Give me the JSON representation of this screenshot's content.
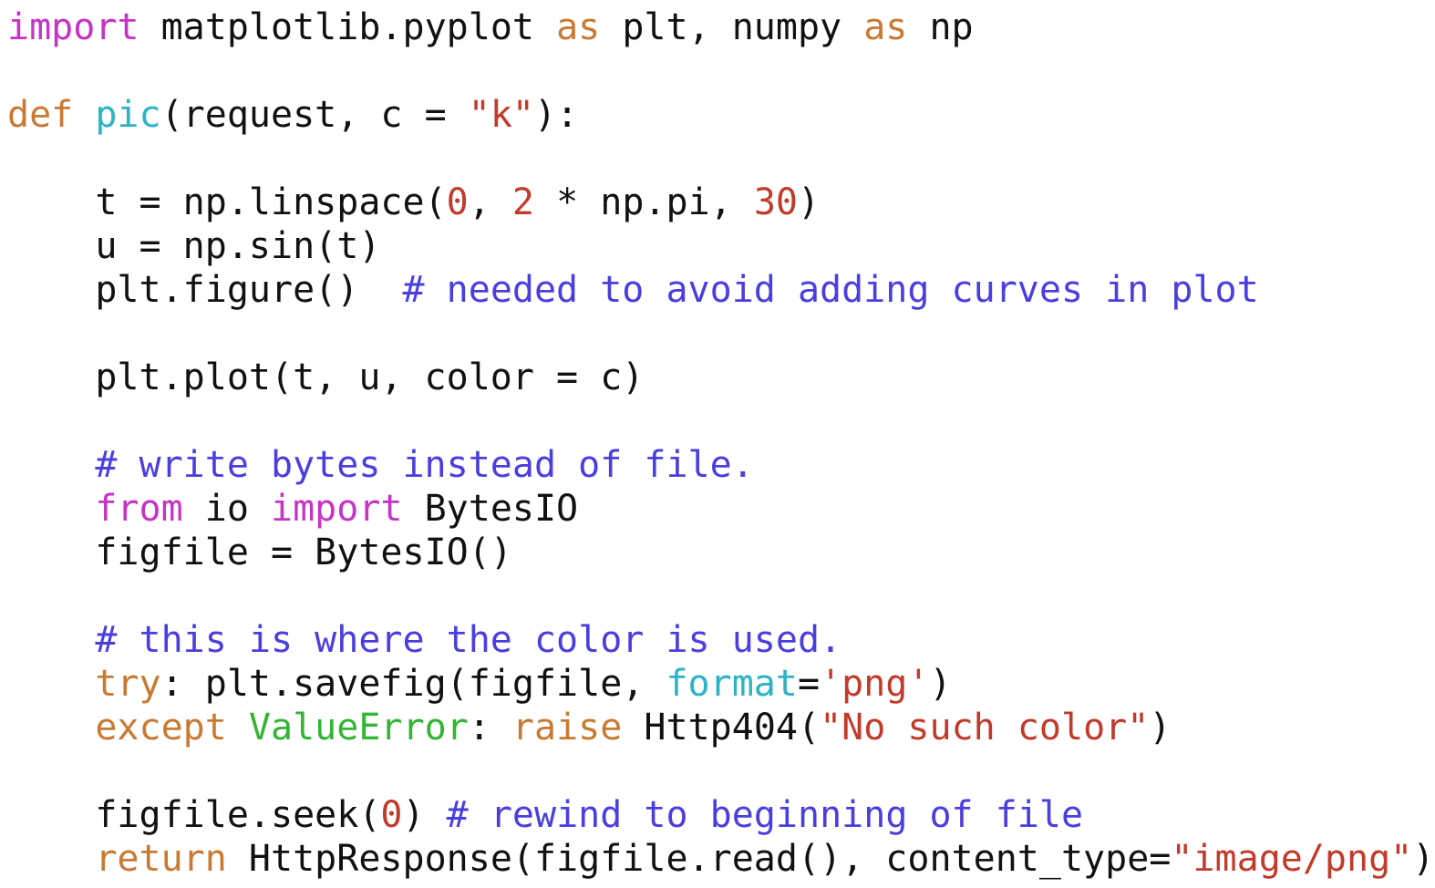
{
  "colors": {
    "plain": "#111111",
    "keyword_import": "#c534c4",
    "keyword": "#c97a32",
    "function": "#2db3c6",
    "string": "#c23a2a",
    "comment": "#4a3ee0",
    "class": "#33b533"
  },
  "code_lines": [
    [
      [
        "import",
        "keyword_import"
      ],
      [
        " matplotlib.pyplot ",
        "plain"
      ],
      [
        "as",
        "keyword"
      ],
      [
        " plt, numpy ",
        "plain"
      ],
      [
        "as",
        "keyword"
      ],
      [
        " np",
        "plain"
      ]
    ],
    [],
    [
      [
        "def",
        "keyword"
      ],
      [
        " ",
        "plain"
      ],
      [
        "pic",
        "function"
      ],
      [
        "(request, c = ",
        "plain"
      ],
      [
        "\"k\"",
        "string"
      ],
      [
        "):",
        "plain"
      ]
    ],
    [],
    [
      [
        "    t = np.linspace(",
        "plain"
      ],
      [
        "0",
        "string"
      ],
      [
        ", ",
        "plain"
      ],
      [
        "2",
        "string"
      ],
      [
        " * np.pi, ",
        "plain"
      ],
      [
        "30",
        "string"
      ],
      [
        ")",
        "plain"
      ]
    ],
    [
      [
        "    u = np.sin(t)",
        "plain"
      ]
    ],
    [
      [
        "    plt.figure()  ",
        "plain"
      ],
      [
        "# needed to avoid adding curves in plot",
        "comment"
      ]
    ],
    [],
    [
      [
        "    plt.plot(t, u, color = c)",
        "plain"
      ]
    ],
    [],
    [
      [
        "    ",
        "plain"
      ],
      [
        "# write bytes instead of file.",
        "comment"
      ]
    ],
    [
      [
        "    ",
        "plain"
      ],
      [
        "from",
        "keyword_import"
      ],
      [
        " io ",
        "plain"
      ],
      [
        "import",
        "keyword_import"
      ],
      [
        " BytesIO",
        "plain"
      ]
    ],
    [
      [
        "    figfile = BytesIO()",
        "plain"
      ]
    ],
    [],
    [
      [
        "    ",
        "plain"
      ],
      [
        "# this is where the color is used.",
        "comment"
      ]
    ],
    [
      [
        "    ",
        "plain"
      ],
      [
        "try",
        "keyword"
      ],
      [
        ": plt.savefig(figfile, ",
        "plain"
      ],
      [
        "format",
        "function"
      ],
      [
        "=",
        "plain"
      ],
      [
        "'png'",
        "string"
      ],
      [
        ")",
        "plain"
      ]
    ],
    [
      [
        "    ",
        "plain"
      ],
      [
        "except",
        "keyword"
      ],
      [
        " ",
        "plain"
      ],
      [
        "ValueError",
        "class"
      ],
      [
        ": ",
        "plain"
      ],
      [
        "raise",
        "keyword"
      ],
      [
        " Http404(",
        "plain"
      ],
      [
        "\"No such color\"",
        "string"
      ],
      [
        ")",
        "plain"
      ]
    ],
    [],
    [
      [
        "    figfile.seek(",
        "plain"
      ],
      [
        "0",
        "string"
      ],
      [
        ") ",
        "plain"
      ],
      [
        "# rewind to beginning of file",
        "comment"
      ]
    ],
    [
      [
        "    ",
        "plain"
      ],
      [
        "return",
        "keyword"
      ],
      [
        " HttpResponse(figfile.read(), content_type=",
        "plain"
      ],
      [
        "\"image/png\"",
        "string"
      ],
      [
        ")",
        "plain"
      ]
    ]
  ]
}
